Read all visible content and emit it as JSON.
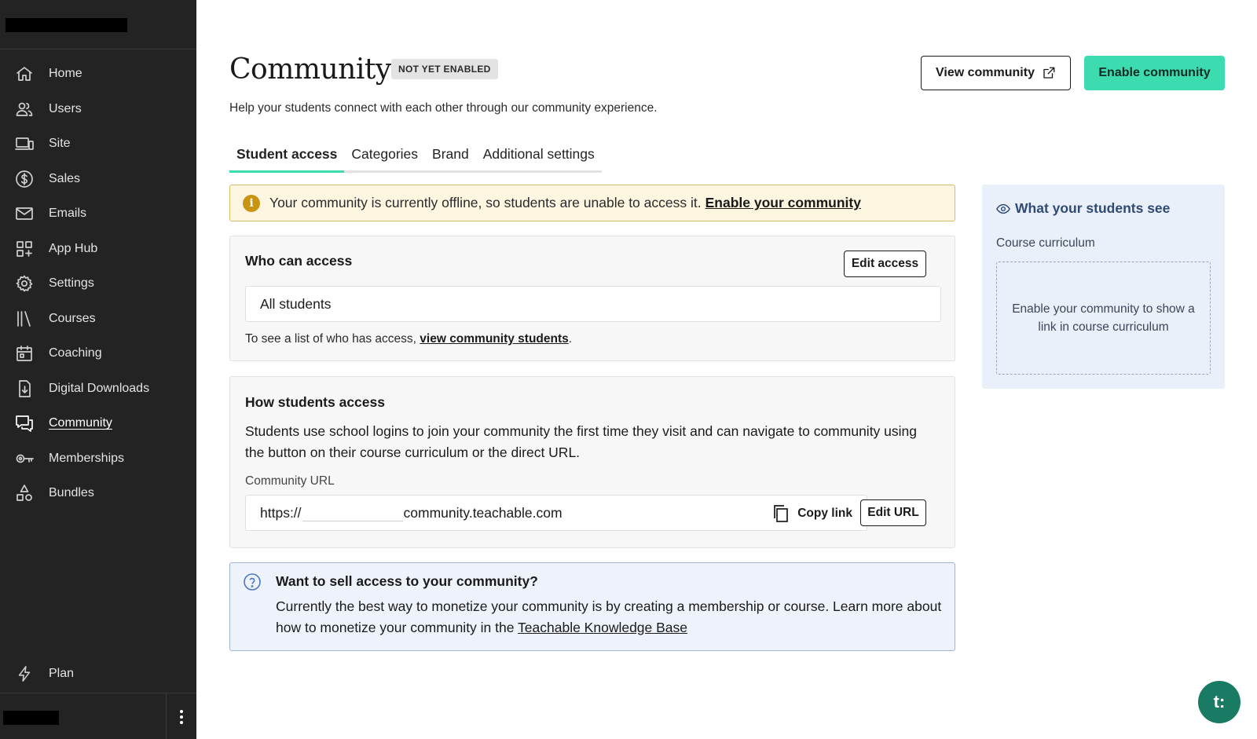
{
  "sidebar": {
    "items": [
      {
        "label": "Home",
        "icon": "home-icon"
      },
      {
        "label": "Users",
        "icon": "users-icon"
      },
      {
        "label": "Site",
        "icon": "site-icon"
      },
      {
        "label": "Sales",
        "icon": "dollar-icon"
      },
      {
        "label": "Emails",
        "icon": "mail-icon"
      },
      {
        "label": "App Hub",
        "icon": "app-grid-icon"
      },
      {
        "label": "Settings",
        "icon": "gear-icon"
      },
      {
        "label": "Courses",
        "icon": "library-icon"
      },
      {
        "label": "Coaching",
        "icon": "calendar-icon"
      },
      {
        "label": "Digital Downloads",
        "icon": "download-file-icon"
      },
      {
        "label": "Community",
        "icon": "chat-icon",
        "active": true
      },
      {
        "label": "Memberships",
        "icon": "key-icon"
      },
      {
        "label": "Bundles",
        "icon": "shapes-icon"
      }
    ],
    "plan_label": "Plan"
  },
  "header": {
    "title": "Community",
    "status_badge": "NOT YET ENABLED",
    "subtitle": "Help your students connect with each other through our community experience.",
    "view_button": "View community",
    "enable_button": "Enable community"
  },
  "tabs": [
    {
      "label": "Student access",
      "active": true
    },
    {
      "label": "Categories"
    },
    {
      "label": "Brand"
    },
    {
      "label": "Additional settings"
    }
  ],
  "alert": {
    "text": "Your community is currently offline, so students are unable to access it.",
    "link": "Enable your community"
  },
  "who_can_access": {
    "title": "Who can access",
    "edit_button": "Edit access",
    "value": "All students",
    "note_prefix": "To see a list of who has access,",
    "note_link": "view community students",
    "note_suffix": "."
  },
  "how_students_access": {
    "title": "How students access",
    "description": "Students use school logins to join your community the first time they visit and can navigate to community using the button on their course curriculum or the direct URL.",
    "url_label": "Community URL",
    "url_prefix": "https://",
    "url_suffix": "community.teachable.com",
    "copy_button": "Copy link",
    "edit_url_button": "Edit URL"
  },
  "sell_info": {
    "title": "Want to sell access to your community?",
    "body": "Currently the best way to monetize your community is by creating a membership or course. Learn more about how to monetize your community in the",
    "link": "Teachable Knowledge Base"
  },
  "preview": {
    "title": "What your students see",
    "label": "Course curriculum",
    "placeholder": "Enable your community to show a link in course curriculum"
  },
  "chat": {
    "label": "t:"
  },
  "colors": {
    "accent": "#3ddbb0",
    "sidebar_bg": "#232323",
    "alert_bg": "#fcf6e0",
    "info_bg": "#eef3fb"
  }
}
